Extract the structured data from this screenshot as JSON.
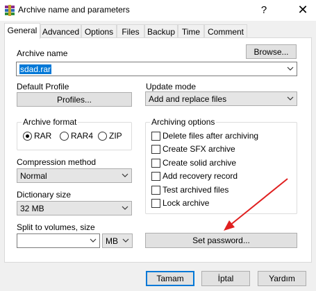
{
  "window": {
    "title": "Archive name and parameters",
    "help_glyph": "?",
    "close_glyph": "✕"
  },
  "tabs": [
    {
      "label": "General",
      "active": true
    },
    {
      "label": "Advanced"
    },
    {
      "label": "Options"
    },
    {
      "label": "Files"
    },
    {
      "label": "Backup"
    },
    {
      "label": "Time"
    },
    {
      "label": "Comment"
    }
  ],
  "archive": {
    "name_label": "Archive name",
    "browse_label": "Browse...",
    "name_value": "sdad.rar"
  },
  "profile": {
    "label": "Default Profile",
    "button_label": "Profiles..."
  },
  "update": {
    "label": "Update mode",
    "value": "Add and replace files"
  },
  "format": {
    "label": "Archive format",
    "options": [
      "RAR",
      "RAR4",
      "ZIP"
    ],
    "selected": "RAR"
  },
  "compression": {
    "label": "Compression method",
    "value": "Normal"
  },
  "dictionary": {
    "label": "Dictionary size",
    "value": "32 MB"
  },
  "split": {
    "label": "Split to volumes, size",
    "value": "",
    "unit": "MB"
  },
  "archiving_options": {
    "label": "Archiving options",
    "items": [
      {
        "label": "Delete files after archiving",
        "checked": false
      },
      {
        "label": "Create SFX archive",
        "checked": false
      },
      {
        "label": "Create solid archive",
        "checked": false
      },
      {
        "label": "Add recovery record",
        "checked": false
      },
      {
        "label": "Test archived files",
        "checked": false
      },
      {
        "label": "Lock archive",
        "checked": false
      }
    ]
  },
  "set_password_label": "Set password...",
  "footer": {
    "ok_label": "Tamam",
    "cancel_label": "İptal",
    "help_label": "Yardım"
  },
  "colors": {
    "accent": "#0078d7",
    "annotation_arrow": "#e02020"
  }
}
